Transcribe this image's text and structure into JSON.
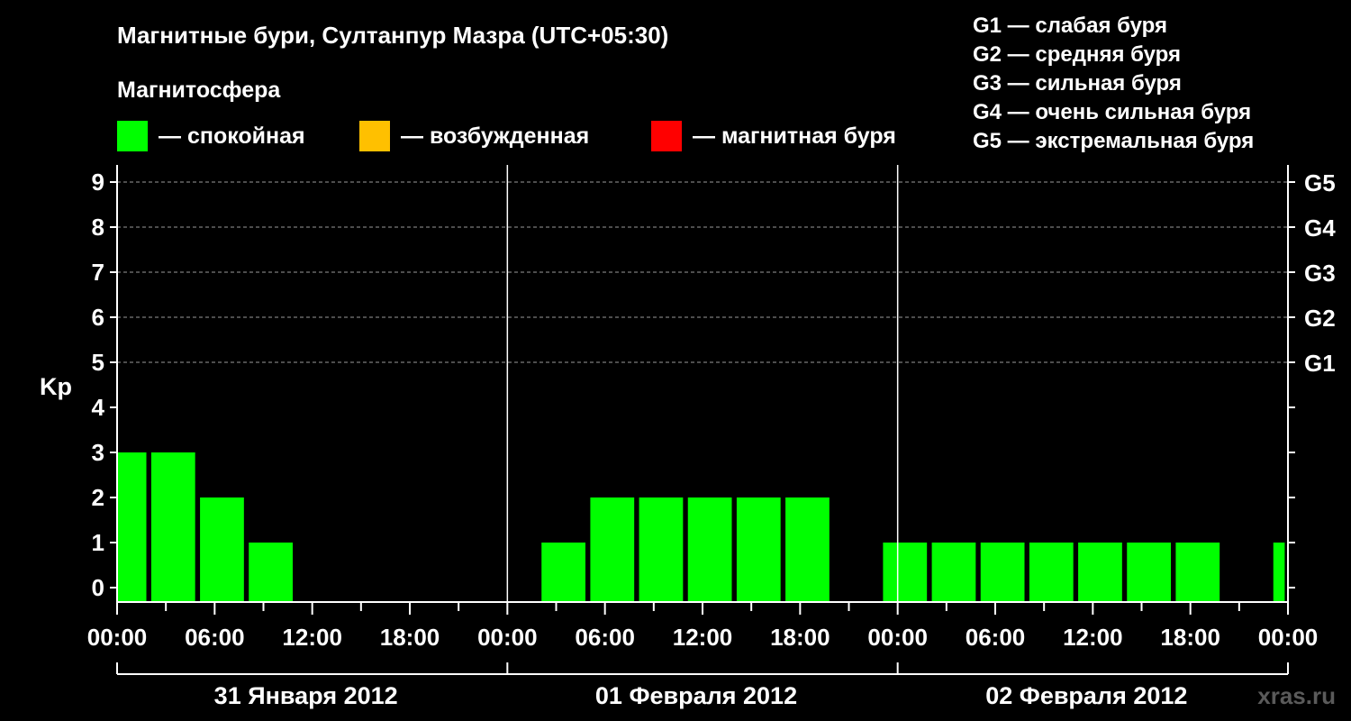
{
  "title": "Магнитные бури, Султанпур Мазра (UTC+05:30)",
  "legend": {
    "heading": "Магнитосфера",
    "items": [
      {
        "label": "— спокойная",
        "color": "#00ff00"
      },
      {
        "label": "— возбужденная",
        "color": "#ffc000"
      },
      {
        "label": "— магнитная буря",
        "color": "#ff0000"
      }
    ]
  },
  "g_levels": [
    "G1 — слабая буря",
    "G2 — средняя буря",
    "G3 — сильная буря",
    "G4 — очень сильная буря",
    "G5 — экстремальная буря"
  ],
  "watermark": "xras.ru",
  "chart_data": {
    "type": "bar",
    "ylabel": "Kp",
    "ylim": [
      0,
      9
    ],
    "y_ticks": [
      0,
      1,
      2,
      3,
      4,
      5,
      6,
      7,
      8,
      9
    ],
    "right_ticks": [
      {
        "value": 5,
        "label": "G1"
      },
      {
        "value": 6,
        "label": "G2"
      },
      {
        "value": 7,
        "label": "G3"
      },
      {
        "value": 8,
        "label": "G4"
      },
      {
        "value": 9,
        "label": "G5"
      }
    ],
    "x_tick_labels": [
      "00:00",
      "06:00",
      "12:00",
      "18:00",
      "00:00",
      "06:00",
      "12:00",
      "18:00",
      "00:00",
      "06:00",
      "12:00",
      "18:00",
      "00:00"
    ],
    "days": [
      "31 Января 2012",
      "01 Февраля 2012",
      "02 Февраля 2012"
    ],
    "bar_color": "#00ff00",
    "grid": "dashed at Kp 5-9",
    "bars": [
      {
        "start_hour": 0,
        "end_hour": 1.8,
        "kp": 3
      },
      {
        "start_hour": 2.1,
        "end_hour": 4.8,
        "kp": 3
      },
      {
        "start_hour": 5.1,
        "end_hour": 7.8,
        "kp": 2
      },
      {
        "start_hour": 8.1,
        "end_hour": 10.8,
        "kp": 1
      },
      {
        "start_hour": 26.1,
        "end_hour": 28.8,
        "kp": 1
      },
      {
        "start_hour": 29.1,
        "end_hour": 31.8,
        "kp": 2
      },
      {
        "start_hour": 32.1,
        "end_hour": 34.8,
        "kp": 2
      },
      {
        "start_hour": 35.1,
        "end_hour": 37.8,
        "kp": 2
      },
      {
        "start_hour": 38.1,
        "end_hour": 40.8,
        "kp": 2
      },
      {
        "start_hour": 41.1,
        "end_hour": 43.8,
        "kp": 2
      },
      {
        "start_hour": 47.1,
        "end_hour": 49.8,
        "kp": 1
      },
      {
        "start_hour": 50.1,
        "end_hour": 52.8,
        "kp": 1
      },
      {
        "start_hour": 53.1,
        "end_hour": 55.8,
        "kp": 1
      },
      {
        "start_hour": 56.1,
        "end_hour": 58.8,
        "kp": 1
      },
      {
        "start_hour": 59.1,
        "end_hour": 61.8,
        "kp": 1
      },
      {
        "start_hour": 62.1,
        "end_hour": 64.8,
        "kp": 1
      },
      {
        "start_hour": 65.1,
        "end_hour": 67.8,
        "kp": 1
      },
      {
        "start_hour": 71.1,
        "end_hour": 71.8,
        "kp": 1
      }
    ]
  }
}
